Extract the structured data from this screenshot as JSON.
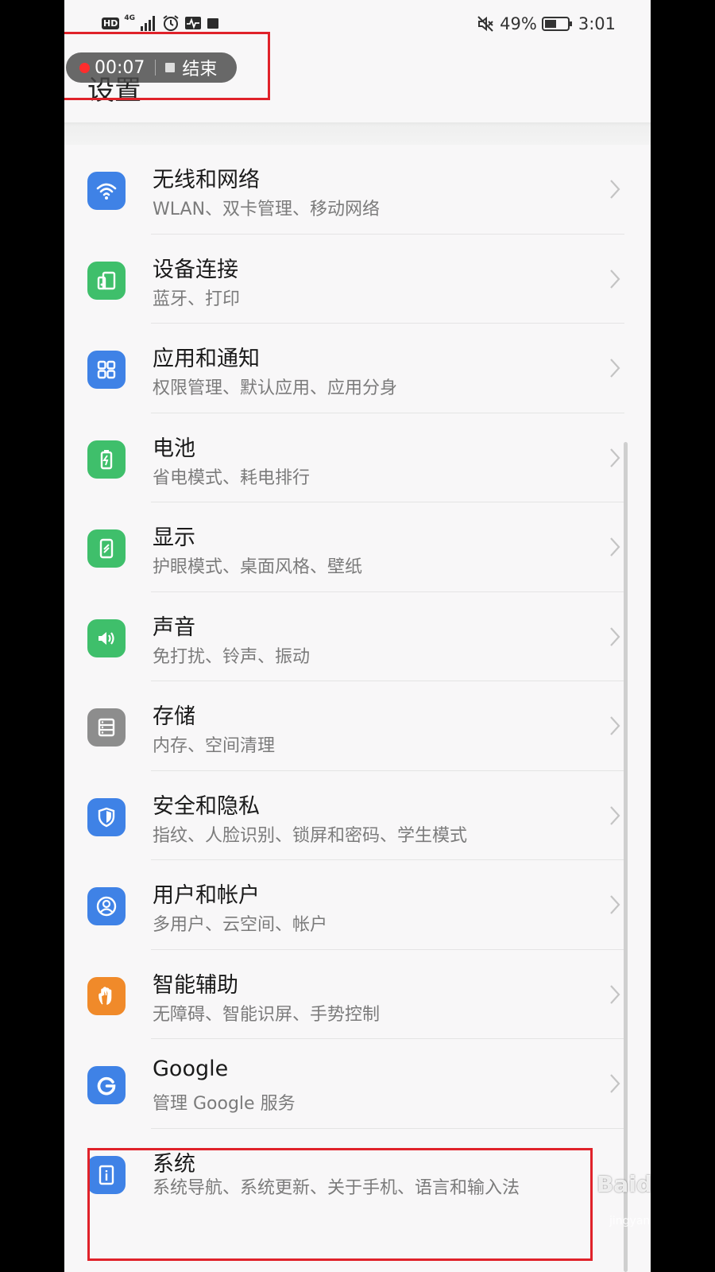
{
  "status_bar": {
    "hd": "HD",
    "network": "4G",
    "battery": "49%",
    "time": "3:01"
  },
  "header": {
    "title": "设置"
  },
  "recorder": {
    "time": "00:07",
    "end_label": "结束"
  },
  "settings": [
    {
      "title": "无线和网络",
      "subtitle": "WLAN、双卡管理、移动网络",
      "icon": "wifi-icon",
      "color": "#3f82e6"
    },
    {
      "title": "设备连接",
      "subtitle": "蓝牙、打印",
      "icon": "device-connection-icon",
      "color": "#3fbf6b"
    },
    {
      "title": "应用和通知",
      "subtitle": "权限管理、默认应用、应用分身",
      "icon": "apps-icon",
      "color": "#3f82e6"
    },
    {
      "title": "电池",
      "subtitle": "省电模式、耗电排行",
      "icon": "battery-icon",
      "color": "#3fbf6b"
    },
    {
      "title": "显示",
      "subtitle": "护眼模式、桌面风格、壁纸",
      "icon": "display-icon",
      "color": "#3fbf6b"
    },
    {
      "title": "声音",
      "subtitle": "免打扰、铃声、振动",
      "icon": "sound-icon",
      "color": "#3fbf6b"
    },
    {
      "title": "存储",
      "subtitle": "内存、空间清理",
      "icon": "storage-icon",
      "color": "#8d8d8d"
    },
    {
      "title": "安全和隐私",
      "subtitle": "指纹、人脸识别、锁屏和密码、学生模式",
      "icon": "shield-icon",
      "color": "#3f82e6"
    },
    {
      "title": "用户和帐户",
      "subtitle": "多用户、云空间、帐户",
      "icon": "user-icon",
      "color": "#3f82e6"
    },
    {
      "title": "智能辅助",
      "subtitle": "无障碍、智能识屏、手势控制",
      "icon": "hand-icon",
      "color": "#f08a2a"
    },
    {
      "title": "Google",
      "subtitle": "管理 Google 服务",
      "icon": "google-icon",
      "color": "#3f82e6"
    },
    {
      "title": "系统",
      "subtitle": "系统导航、系统更新、关于手机、语言和输入法",
      "icon": "system-info-icon",
      "color": "#3f82e6"
    }
  ],
  "annotation_color": "#e0222a",
  "watermark": {
    "brand": "Baidu 经验",
    "url": "jingyan.baidu.com"
  }
}
